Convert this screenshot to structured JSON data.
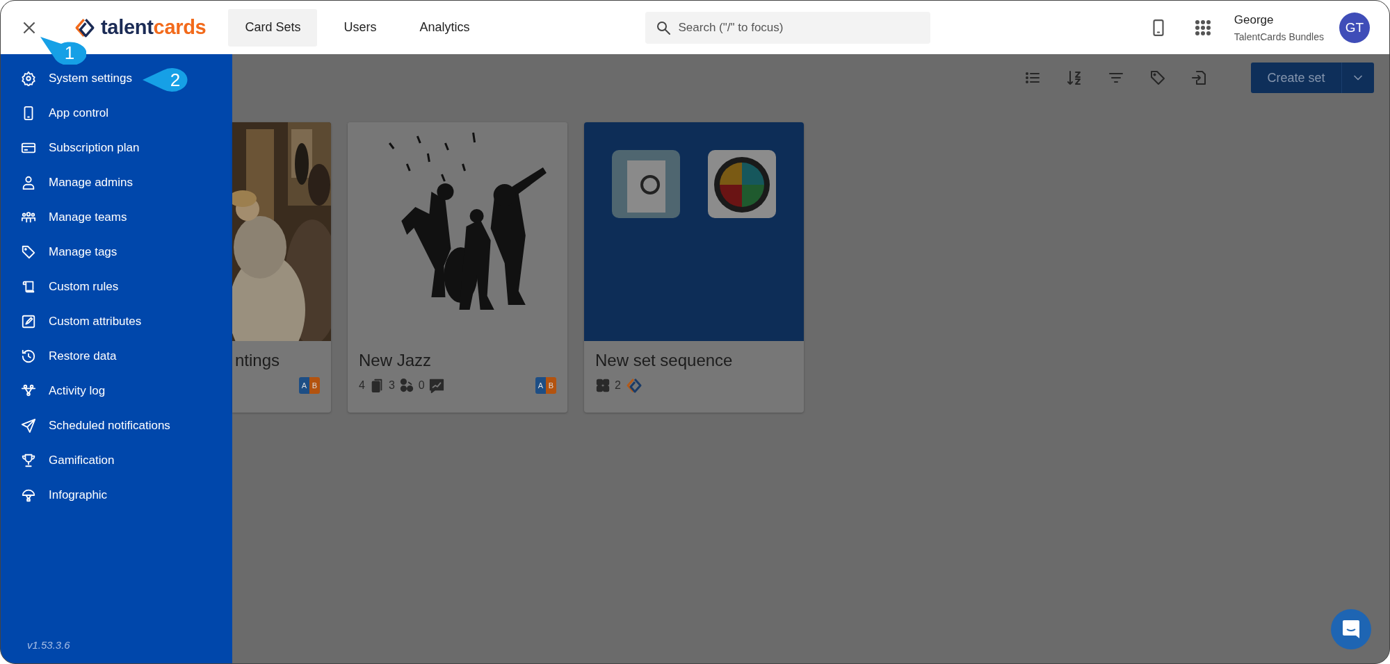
{
  "header": {
    "logo": {
      "part_1": "talent",
      "part_2": "cards"
    },
    "tabs": [
      {
        "label": "Card Sets",
        "selected": true
      },
      {
        "label": "Users",
        "selected": false
      },
      {
        "label": "Analytics",
        "selected": false
      }
    ],
    "search": {
      "placeholder": "Search (\"/\" to focus)"
    },
    "user": {
      "name": "George",
      "organization": "TalentCards Bundles",
      "initials": "GT"
    }
  },
  "sidebar": {
    "items": [
      {
        "label": "System settings",
        "kind": "gear"
      },
      {
        "label": "App control",
        "kind": "phone"
      },
      {
        "label": "Subscription plan",
        "kind": "card"
      },
      {
        "label": "Manage admins",
        "kind": "person"
      },
      {
        "label": "Manage teams",
        "kind": "people"
      },
      {
        "label": "Manage tags",
        "kind": "tag"
      },
      {
        "label": "Custom rules",
        "kind": "scroll"
      },
      {
        "label": "Custom attributes",
        "kind": "edit"
      },
      {
        "label": "Restore data",
        "kind": "history"
      },
      {
        "label": "Activity log",
        "kind": "nodes"
      },
      {
        "label": "Scheduled notifications",
        "kind": "plane"
      },
      {
        "label": "Gamification",
        "kind": "trophy"
      },
      {
        "label": "Infographic",
        "kind": "parachute"
      }
    ],
    "version": "v1.53.3.6"
  },
  "toolbar": {
    "create_button": "Create set"
  },
  "cards": [
    {
      "title": "ntings",
      "kind": "painting",
      "badge": {
        "left": "A",
        "right": "B"
      }
    },
    {
      "title": "New Jazz",
      "kind": "illustration",
      "stats": [
        {
          "kind": "text",
          "text": "4"
        },
        {
          "kind": "cards"
        },
        {
          "kind": "text",
          "text": "3"
        },
        {
          "kind": "network"
        },
        {
          "kind": "text",
          "text": "0"
        },
        {
          "kind": "signature"
        }
      ],
      "badge": {
        "left": "A",
        "right": "B"
      }
    },
    {
      "title": "New set sequence",
      "kind": "app-icons",
      "stats": [
        {
          "kind": "grid"
        },
        {
          "kind": "text",
          "text": "2"
        },
        {
          "kind": "logo"
        }
      ]
    }
  ],
  "callouts": [
    {
      "number": "1",
      "kind": "up-left"
    },
    {
      "number": "2",
      "kind": "left"
    }
  ]
}
